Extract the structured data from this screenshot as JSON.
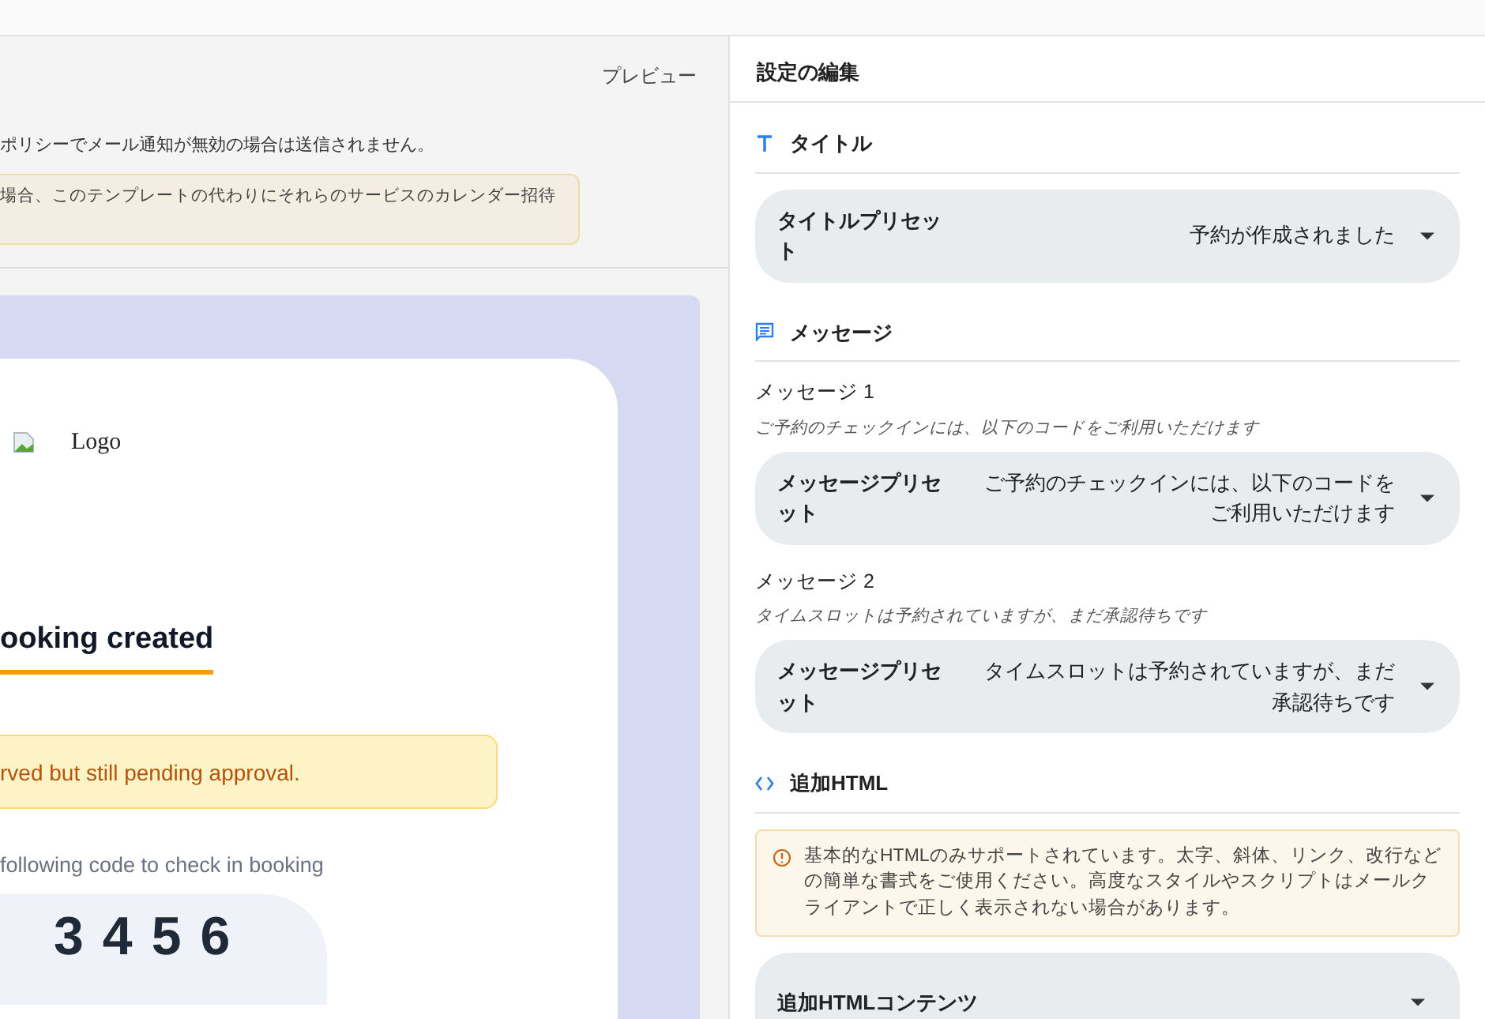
{
  "preview": {
    "label": "プレビュー",
    "notice": "ポリシーでメール通知が無効の場合は送信されません。",
    "warning": "場合、このテンプレートの代わりにそれらのサービスのカレンダー招待",
    "email": {
      "logo_alt": "Logo",
      "heading": "ooking created",
      "alert": "rved but still pending approval.",
      "instruction": "following code to check in booking",
      "code": "3456"
    }
  },
  "editor": {
    "title": "設定の編集",
    "sections": [
      {
        "kind": "title",
        "heading": "タイトル",
        "fields": [
          {
            "kind": "select",
            "label": "タイトルプリセット",
            "value": "予約が作成されました"
          }
        ]
      },
      {
        "kind": "message",
        "heading": "メッセージ",
        "fields": [
          {
            "kind": "select",
            "caption": "メッセージ 1",
            "hint": "ご予約のチェックインには、以下のコードをご利用いただけます",
            "label": "メッセージプリセット",
            "value": "ご予約のチェックインには、以下のコードをご利用いただけます"
          },
          {
            "kind": "select",
            "caption": "メッセージ 2",
            "hint": "タイムスロットは予約されていますが、まだ承認待ちです",
            "label": "メッセージプリセット",
            "value": "タイムスロットは予約されていますが、まだ承認待ちです"
          }
        ]
      },
      {
        "kind": "html",
        "heading": "追加HTML",
        "info": "基本的なHTMLのみサポートされています。太字、斜体、リンク、改行などの簡単な書式をご使用ください。高度なスタイルやスクリプトはメールクライアントで正しく表示されない場合があります。",
        "fields": [
          {
            "kind": "textarea",
            "label": "追加HTMLコンテンツ"
          }
        ]
      }
    ]
  }
}
